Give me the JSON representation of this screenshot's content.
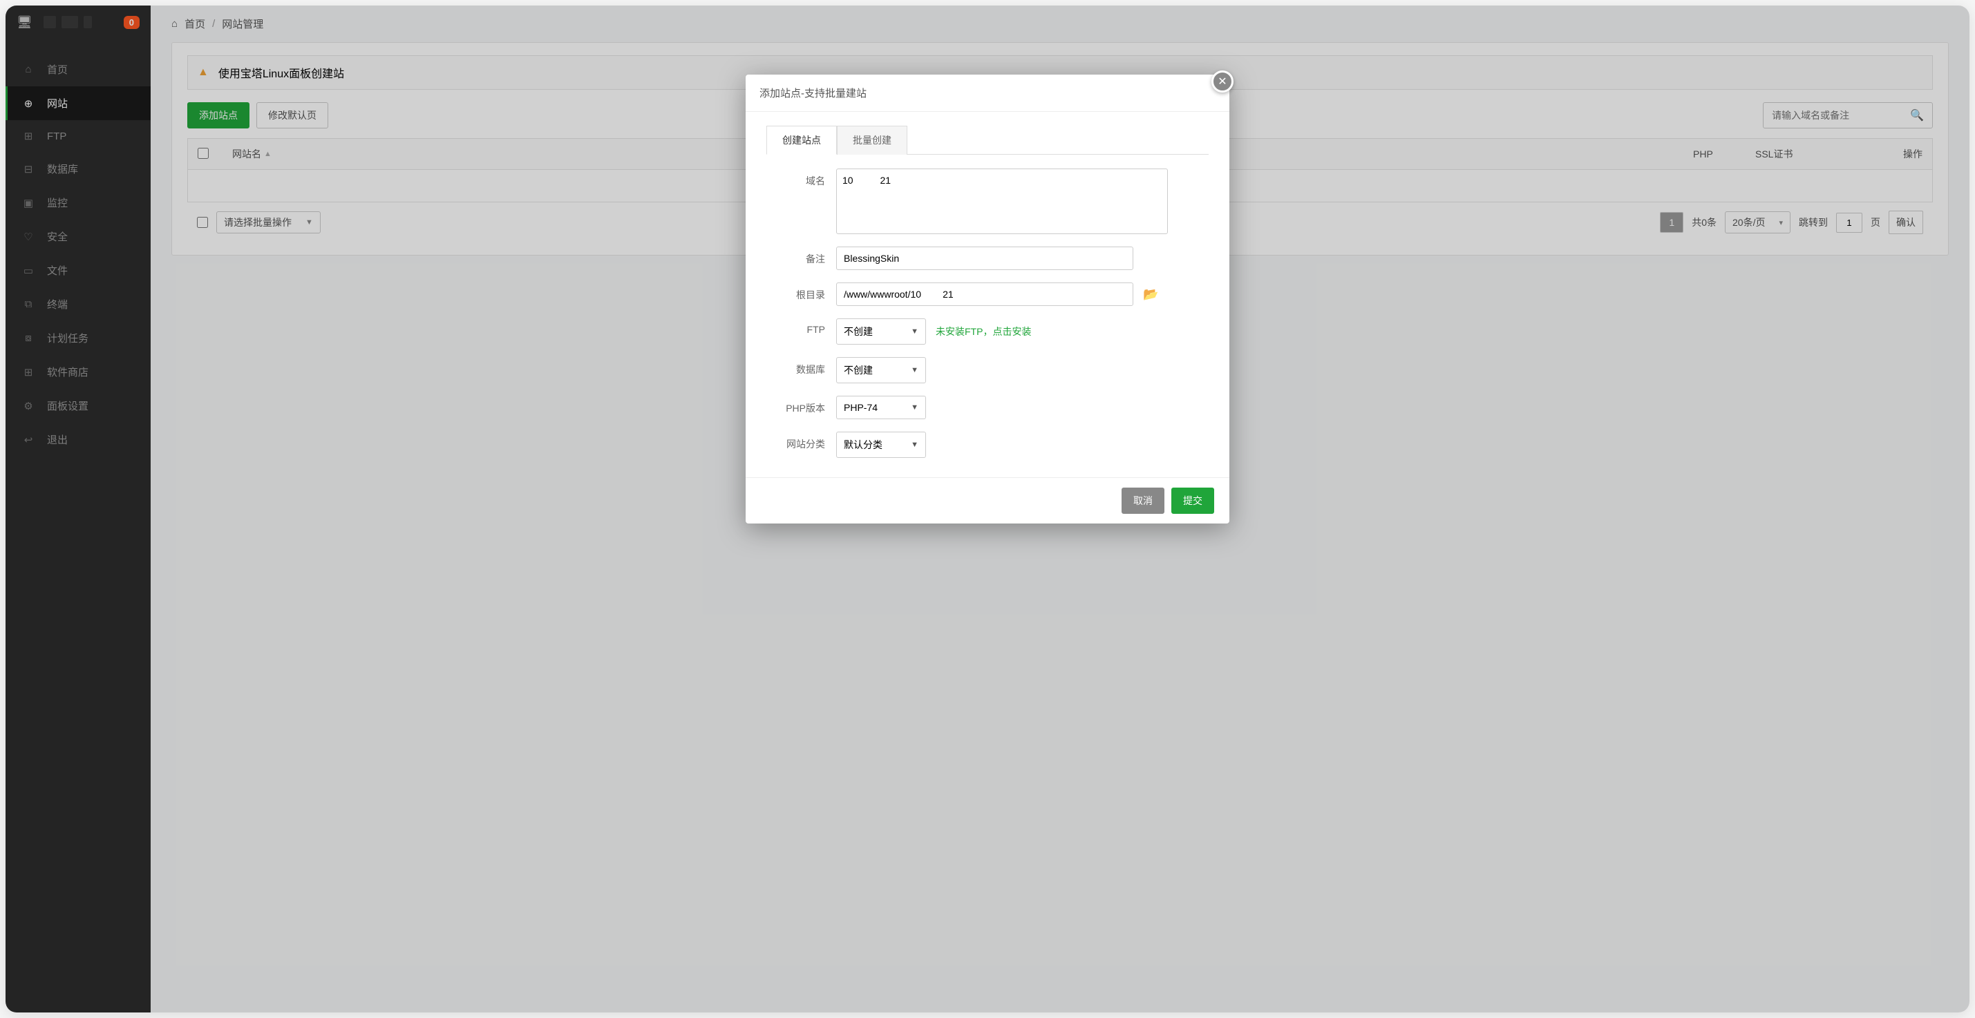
{
  "topbar": {
    "badge": "0"
  },
  "sidebar": {
    "items": [
      {
        "label": "首页",
        "icon": "⌂"
      },
      {
        "label": "网站",
        "icon": "⊕"
      },
      {
        "label": "FTP",
        "icon": "⊞"
      },
      {
        "label": "数据库",
        "icon": "⊟"
      },
      {
        "label": "监控",
        "icon": "▣"
      },
      {
        "label": "安全",
        "icon": "♡"
      },
      {
        "label": "文件",
        "icon": "▭"
      },
      {
        "label": "终端",
        "icon": "⧉"
      },
      {
        "label": "计划任务",
        "icon": "⧇"
      },
      {
        "label": "软件商店",
        "icon": "⊞"
      },
      {
        "label": "面板设置",
        "icon": "⚙"
      },
      {
        "label": "退出",
        "icon": "↩"
      }
    ]
  },
  "breadcrumb": {
    "home": "首页",
    "current": "网站管理"
  },
  "alert": {
    "text": "使用宝塔Linux面板创建站"
  },
  "toolbar": {
    "add": "添加站点",
    "default_page": "修改默认页",
    "search_placeholder": "请输入域名或备注"
  },
  "table": {
    "headers": {
      "name": "网站名",
      "php": "PHP",
      "ssl": "SSL证书",
      "op": "操作"
    },
    "batch_placeholder": "请选择批量操作",
    "total": "共0条",
    "per_page": "20条/页",
    "jump": "跳转到",
    "page": "页",
    "confirm": "确认",
    "current_page": "1",
    "jump_value": "1"
  },
  "modal": {
    "title": "添加站点-支持批量建站",
    "tabs": {
      "single": "创建站点",
      "batch": "批量创建"
    },
    "labels": {
      "domain": "域名",
      "remark": "备注",
      "root": "根目录",
      "ftp": "FTP",
      "db": "数据库",
      "php": "PHP版本",
      "cat": "网站分类"
    },
    "values": {
      "domain_prefix": "10",
      "domain_suffix": "21",
      "remark": "BlessingSkin",
      "root_prefix": "/www/wwwroot/10",
      "root_suffix": "21",
      "ftp": "不创建",
      "db": "不创建",
      "php": "PHP-74",
      "cat": "默认分类"
    },
    "ftp_hint": "未安装FTP，点击安装",
    "actions": {
      "cancel": "取消",
      "submit": "提交"
    }
  }
}
